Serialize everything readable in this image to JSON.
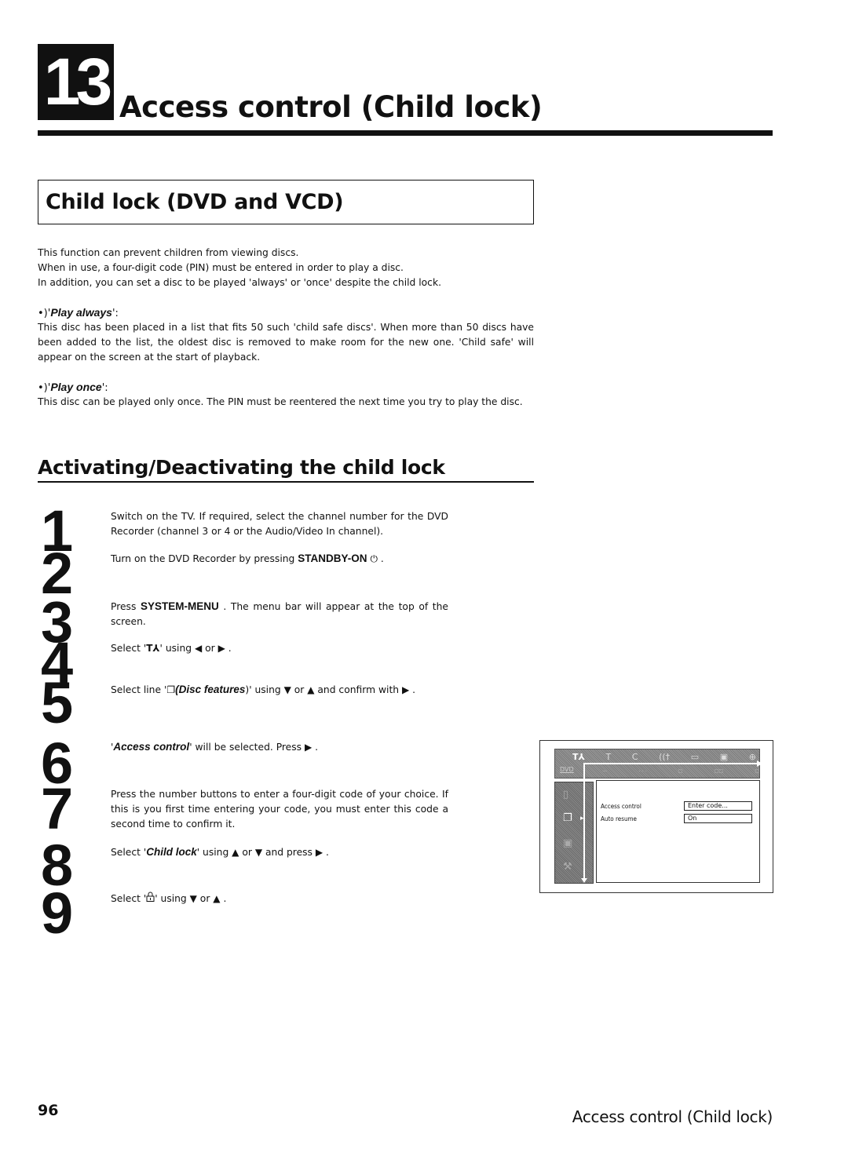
{
  "chapter": {
    "number": "13",
    "title": "Access control (Child lock)"
  },
  "section1": {
    "title": "Child lock (DVD and VCD)",
    "intro": [
      "This function can prevent children from viewing discs.",
      "When in use, a four-digit code (PIN) must be entered in order to play a disc.",
      "In addition, you can set a disc to be played 'always' or 'once' despite the child lock."
    ],
    "options": [
      {
        "prefix": "•)'",
        "label": "Play always",
        "suffix": "':",
        "description": "This disc has been placed in a list that fits 50 such 'child safe discs'. When more than 50 discs have been added to the list, the oldest disc is removed to make room for the new one. 'Child safe' will appear on the screen at the start of playback."
      },
      {
        "prefix": "•)'",
        "label": "Play once",
        "suffix": "':",
        "description": "This disc can be played only once. The PIN must be reentered the next time you try to play the disc."
      }
    ]
  },
  "section2": {
    "title": "Activating/Deactivating the child lock",
    "steps": [
      {
        "number": "1",
        "text": "Switch on the TV. If required, select the channel number for the DVD Recorder (channel 3 or 4 or the Audio/Video In channel)."
      },
      {
        "number": "2",
        "pre": "Turn on the DVD Recorder by pressing ",
        "key": "STANDBY-ON",
        "icon": "⏻",
        "post": " ."
      },
      {
        "number": "3",
        "pre": "Press ",
        "key": "SYSTEM-MENU",
        "post": " . The menu bar will appear at the top of the screen."
      },
      {
        "number": "4",
        "pre": "Select '",
        "icon": "T⅄",
        "mid": "' using ",
        "arrow1": "◀",
        "or": " or ",
        "arrow2": "▶",
        "post": " ."
      },
      {
        "number": "5",
        "pre": "Select line '",
        "icon": "❐",
        "ital": "(Disc features",
        "mid": ")' using ",
        "arrow1": "▼",
        "or": " or ",
        "arrow2": "▲",
        "post": " and confirm with ",
        "arrow3": "▶",
        "end": " ."
      },
      {
        "number": "6",
        "pre": "'",
        "ital": "Access control",
        "mid": "' will be selected. Press ",
        "arrow1": "▶",
        "post": " ."
      },
      {
        "number": "7",
        "text": "Press the number buttons to enter a four-digit code of your choice. If this is you first time entering your code, you must enter this code a second time to confirm it."
      },
      {
        "number": "8",
        "pre": "Select '",
        "ital": "Child lock",
        "mid": "' using ",
        "arrow1": "▲",
        "or": " or ",
        "arrow2": "▼",
        "post": " and press ",
        "arrow3": "▶",
        "end": " ."
      },
      {
        "number": "9",
        "pre": "Select '",
        "icon": "🔒",
        "mid": "' using ",
        "arrow1": "▼",
        "or": " or ",
        "arrow2": "▲",
        "post": " ."
      }
    ]
  },
  "tv_screen": {
    "menu_bar_icons": [
      "T⅄",
      "T",
      "C",
      "((†",
      "▭",
      "▣",
      "⊕"
    ],
    "dvd_label": "DVD",
    "side_icons": [
      "▯",
      "❐",
      "▣",
      "⚒"
    ],
    "rows": [
      {
        "label": "Access control",
        "value": "Enter code..."
      },
      {
        "label": "Auto resume",
        "value": "On"
      }
    ]
  },
  "footer": {
    "page_number": "96",
    "title": "Access control (Child lock)"
  }
}
